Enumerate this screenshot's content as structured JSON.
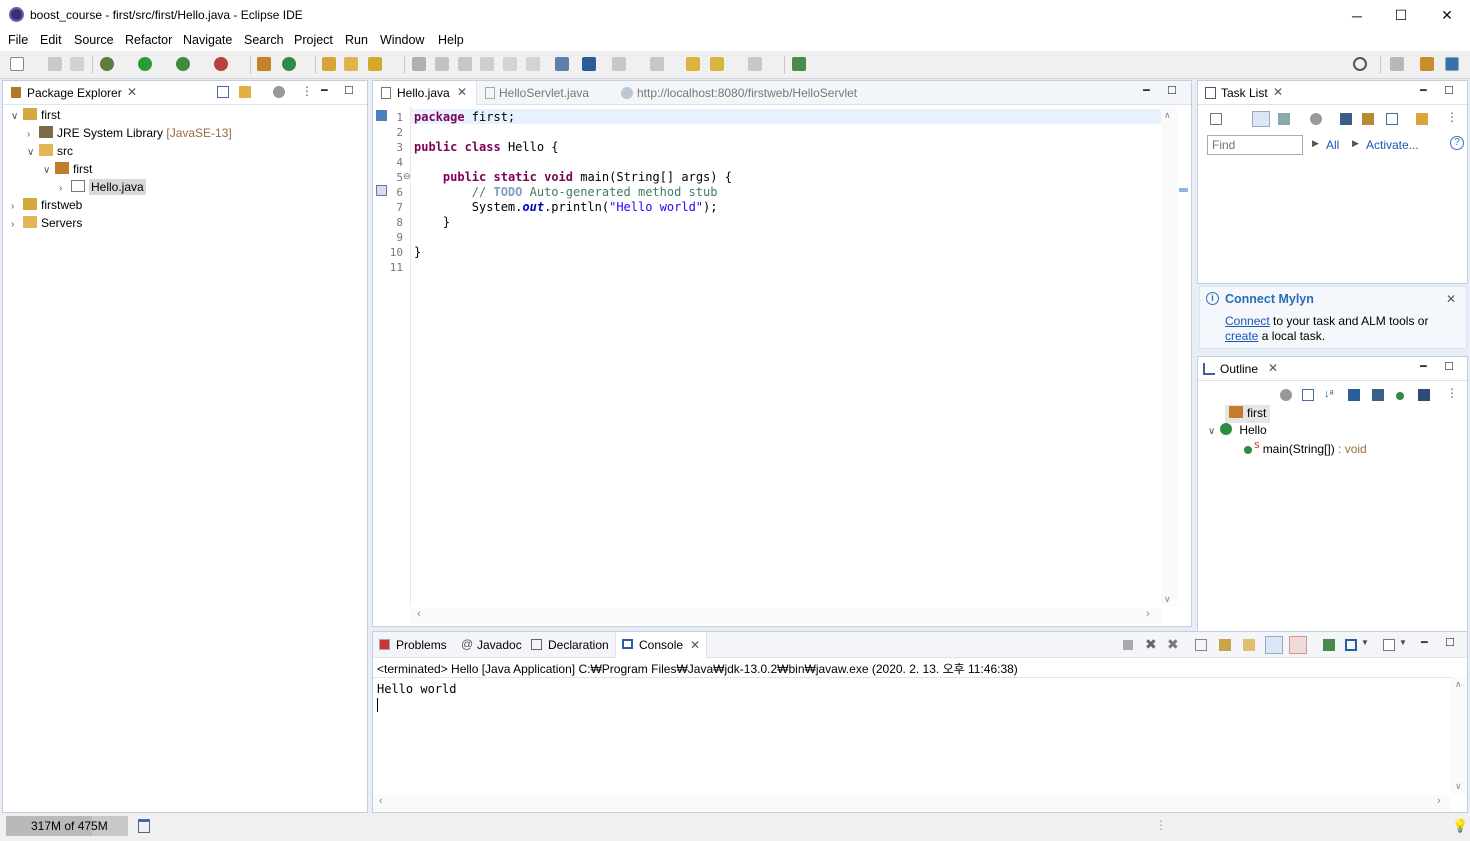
{
  "window": {
    "title": "boost_course - first/src/first/Hello.java - Eclipse IDE",
    "minimize": "─",
    "maximize": "☐",
    "close": "✕"
  },
  "menu": [
    "File",
    "Edit",
    "Source",
    "Refactor",
    "Navigate",
    "Search",
    "Project",
    "Run",
    "Window",
    "Help"
  ],
  "package_explorer": {
    "title": "Package Explorer",
    "tree": [
      {
        "label": "first",
        "depth": 0,
        "expanded": true,
        "icon": "project-icon"
      },
      {
        "label": "JRE System Library",
        "extra": "[JavaSE-13]",
        "depth": 1,
        "expanded": false,
        "icon": "library-icon"
      },
      {
        "label": "src",
        "depth": 1,
        "expanded": true,
        "icon": "source-folder-icon"
      },
      {
        "label": "first",
        "depth": 2,
        "expanded": true,
        "icon": "package-icon"
      },
      {
        "label": "Hello.java",
        "depth": 3,
        "expanded": false,
        "icon": "java-file-icon",
        "selected": true
      },
      {
        "label": "firstweb",
        "depth": 0,
        "expanded": false,
        "icon": "project-icon"
      },
      {
        "label": "Servers",
        "depth": 0,
        "expanded": false,
        "icon": "folder-icon"
      }
    ]
  },
  "editor": {
    "tabs": [
      {
        "label": "Hello.java",
        "active": true
      },
      {
        "label": "HelloServlet.java",
        "active": false
      },
      {
        "label": "http://localhost:8080/firstweb/HelloServlet",
        "active": false
      }
    ],
    "line_numbers": [
      "1",
      "2",
      "3",
      "4",
      "5",
      "6",
      "7",
      "8",
      "9",
      "10",
      "11"
    ]
  },
  "task_list": {
    "title": "Task List",
    "find_placeholder": "Find",
    "all": "All",
    "activate": "Activate...",
    "mylyn_title": "Connect Mylyn",
    "mylyn_connect": "Connect",
    "mylyn_text1": " to your task and ALM tools or",
    "mylyn_create": "create",
    "mylyn_text2": " a local task."
  },
  "outline": {
    "title": "Outline",
    "package": "first",
    "class": "Hello",
    "method": "main(String[])",
    "method_type": " : void",
    "static_marker": "S"
  },
  "bottom": {
    "tabs": [
      "Problems",
      "Javadoc",
      "Declaration",
      "Console"
    ],
    "terminated": "<terminated> Hello [Java Application] C:₩Program Files₩Java₩jdk-13.0.2₩bin₩javaw.exe (2020. 2. 13. 오후 11:46:38)",
    "output": "Hello world"
  },
  "status": {
    "memory": "317M of 475M"
  }
}
